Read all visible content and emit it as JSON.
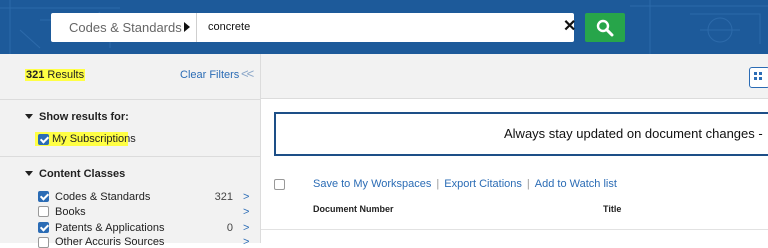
{
  "search": {
    "scope_label": "Codes & Standards",
    "query": "concrete",
    "clear_icon": "close-icon",
    "submit_icon": "search-icon"
  },
  "sidebar": {
    "results_count": "321",
    "results_word": "Results",
    "clear_filters": "Clear Filters",
    "collapse_symbol": "<<",
    "show_results_title": "Show results for:",
    "my_subscriptions": {
      "label": "My Subscriptions",
      "checked": true
    },
    "content_classes_title": "Content Classes",
    "content_classes": [
      {
        "label": "Codes & Standards",
        "count": "321",
        "checked": true,
        "arrow": ">"
      },
      {
        "label": "Books",
        "count": "",
        "checked": false,
        "arrow": ">"
      },
      {
        "label": "Patents & Applications",
        "count": "0",
        "checked": true,
        "arrow": ">"
      },
      {
        "label": "Other Accuris Sources",
        "count": "",
        "checked": false,
        "arrow": ">"
      }
    ]
  },
  "main": {
    "banner_text": "Always stay updated on document changes -",
    "actions": [
      "Save to My Workspaces",
      "Export Citations",
      "Add to Watch list"
    ],
    "columns": [
      "Document Number",
      "Title"
    ]
  },
  "colors": {
    "header_bg": "#1d5a9a",
    "search_button": "#27a54a",
    "link": "#2b6cb5",
    "highlight": "#ffff44",
    "banner_border": "#1d4f87"
  }
}
